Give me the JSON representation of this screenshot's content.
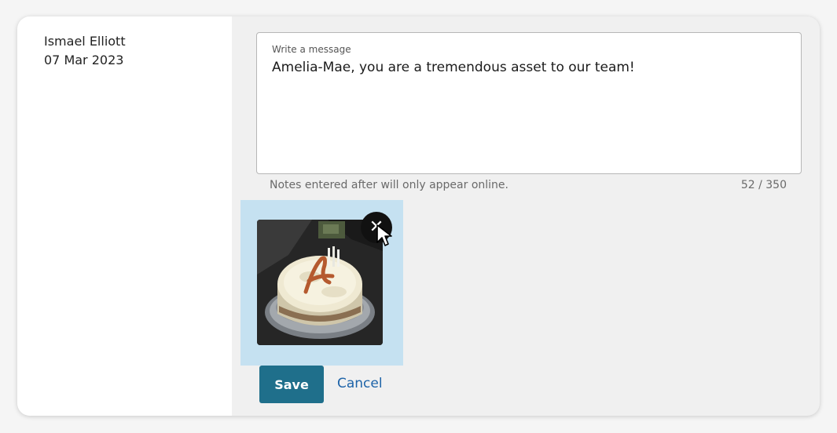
{
  "note": {
    "author_name": "Ismael Elliott",
    "date": "07 Mar 2023"
  },
  "editor": {
    "label": "Write a message",
    "message": "Amelia-Mae, you are a tremendous asset to our team!",
    "helper_text": "Notes entered after will only appear online.",
    "char_count": "52 / 350"
  },
  "attachment": {
    "image_alt": "Photo of a frosted cake decorated with a letter and candles",
    "remove_icon": "close-icon"
  },
  "actions": {
    "save_label": "Save",
    "cancel_label": "Cancel"
  },
  "colors": {
    "accent": "#1f6f8b",
    "link": "#1d63a8",
    "attachment_highlight": "#c5e1f1"
  }
}
